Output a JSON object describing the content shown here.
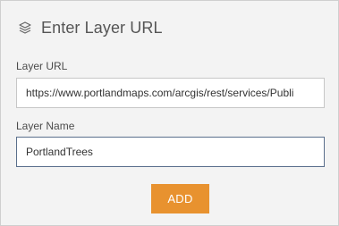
{
  "dialog": {
    "title": "Enter Layer URL",
    "icon": "layers-icon"
  },
  "form": {
    "url_label": "Layer URL",
    "url_value": "https://www.portlandmaps.com/arcgis/rest/services/Publi",
    "name_label": "Layer Name",
    "name_value": "PortlandTrees",
    "add_label": "ADD"
  },
  "colors": {
    "panel_background": "#f3f3f3",
    "accent_button": "#e8922f",
    "focused_border": "#5a6f8c"
  }
}
